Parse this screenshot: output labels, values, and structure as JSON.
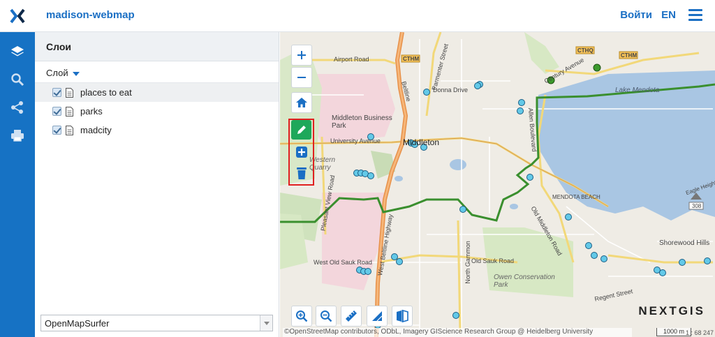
{
  "header": {
    "app_title": "madison-webmap",
    "login_label": "Войти",
    "lang_label": "EN"
  },
  "rail": {
    "items": [
      "layers-icon",
      "search-icon",
      "share-icon",
      "print-icon"
    ]
  },
  "panel": {
    "title": "Слои",
    "layer_menu_label": "Слой",
    "layers": [
      {
        "label": "places to eat",
        "checked": true
      },
      {
        "label": "parks",
        "checked": true
      },
      {
        "label": "madcity",
        "checked": true
      }
    ],
    "basemap": "OpenMapSurfer"
  },
  "map": {
    "labels": {
      "airport_road": "Airport Road",
      "donna_drive": "Donna Drive",
      "middleton_business_park": "Middleton Business Park",
      "university_avenue": "University Avenue",
      "middleton": "Middleton",
      "western_quarry": "Western Quarry",
      "beltline": "Beltline",
      "west_beltline_highway": "West Beltline Highway",
      "west_old_sauk_road": "West Old Sauk Road",
      "north_gammon": "North Gammon",
      "old_sauk_road": "Old Sauk Road",
      "owen_conservation_park": "Owen Conservation Park",
      "regent_street": "Regent Street",
      "mendota_beach": "MENDOTA BEACH",
      "lake_mendota": "Lake Mendota",
      "shorewood_hills": "Shorewood Hills",
      "century_avenue": "Century Avenue",
      "pleasant_view_road": "Pleasant View Road",
      "allen_boulevard": "Allen Boulevard",
      "old_middleton_road": "Old Middleton Road",
      "parmenter_street": "Parmenter Street",
      "cthm": "CTHM",
      "cthq": "CTHQ",
      "route_308": "308",
      "eagle_heights": "Eagle Heights"
    },
    "brand": "NEXTGIS",
    "attribution": "©OpenStreetMap contributors, ODbL, Imagery GIScience Research Group @ Heidelberg University",
    "scale_label": "1000 m",
    "scale_ratio": "1 : 68 247"
  },
  "colors": {
    "accent": "#1a6fc4",
    "rail": "#1672c4",
    "edit_green": "#1ea85a",
    "highlight_red": "#e02020",
    "park_boundary": "#3a8f2e",
    "lake": "#a9c6e3"
  }
}
